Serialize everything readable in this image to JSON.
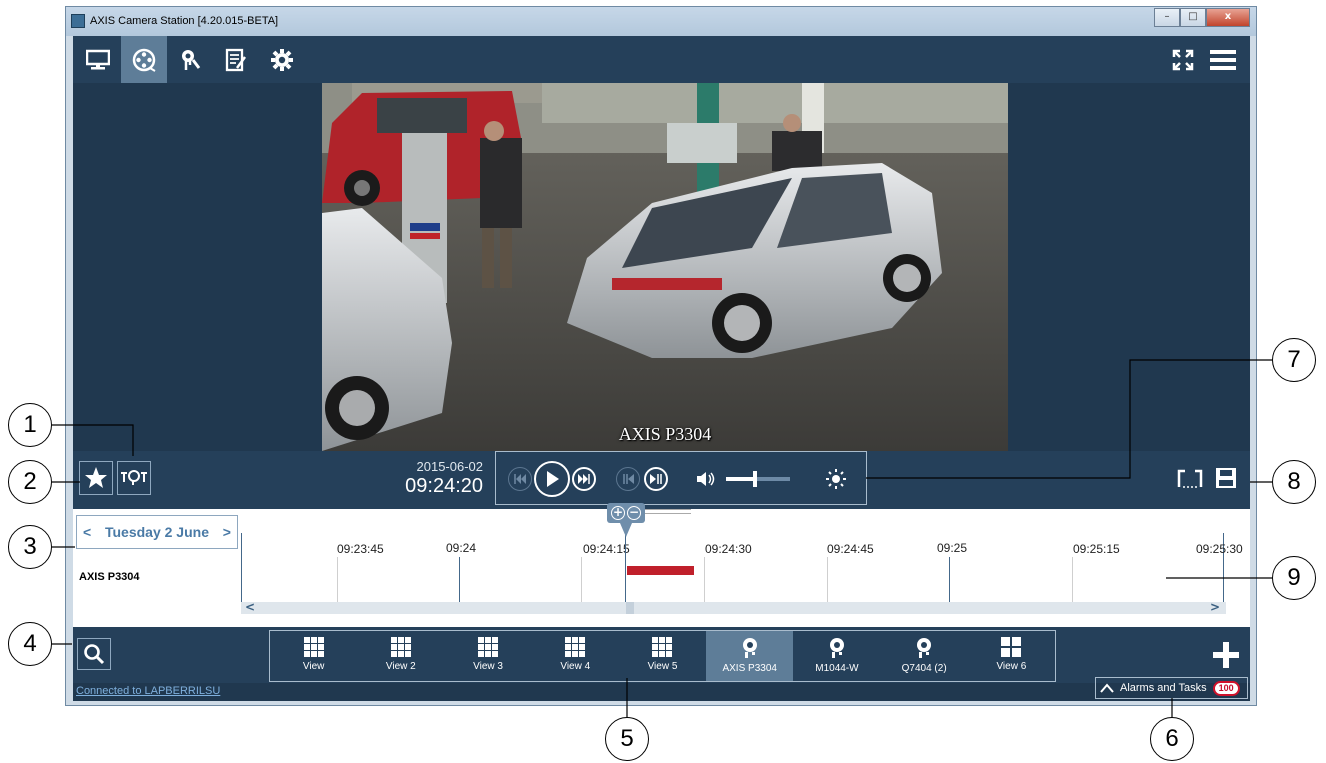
{
  "window": {
    "title": "AXIS Camera Station [4.20.015-BETA]",
    "controls": {
      "minimize": "–",
      "maximize": "□",
      "close": "x"
    }
  },
  "toolbar": {
    "tabs": [
      {
        "name": "live-view",
        "icon": "monitor-icon"
      },
      {
        "name": "recordings",
        "icon": "film-reel-icon",
        "active": true
      },
      {
        "name": "configuration",
        "icon": "camera-wrench-icon"
      },
      {
        "name": "logs",
        "icon": "report-icon"
      },
      {
        "name": "settings",
        "icon": "gear-icon"
      }
    ],
    "right": [
      {
        "icon": "fullscreen-icon"
      },
      {
        "icon": "hamburger-menu-icon"
      }
    ]
  },
  "video": {
    "caption": "AXIS P3304"
  },
  "controls": {
    "date": "2015-06-02",
    "time": "09:24:20",
    "left_buttons": [
      {
        "icon": "star-icon"
      },
      {
        "icon": "camera-tag-icon"
      }
    ],
    "playback": [
      "skip-back-icon",
      "play-icon",
      "skip-forward-icon",
      "step-back-icon",
      "step-forward-icon"
    ],
    "volume_icon": "speaker-icon",
    "volume_level": 0.45,
    "brightness_icon": "brightness-icon",
    "right_buttons": [
      {
        "icon": "export-markers-icon"
      },
      {
        "icon": "save-icon"
      }
    ],
    "zoom": {
      "plus": "+",
      "minus": "−"
    }
  },
  "timeline": {
    "date_label": "Tuesday 2 June",
    "prev": "<",
    "next": ">",
    "camera": "AXIS P3304",
    "ticks": [
      {
        "label": "09:23:45",
        "major": false
      },
      {
        "label": "09:24",
        "major": true
      },
      {
        "label": "09:24:15",
        "major": false
      },
      {
        "label": "09:24:30",
        "major": false
      },
      {
        "label": "09:24:45",
        "major": false
      },
      {
        "label": "09:25",
        "major": true
      },
      {
        "label": "09:25:15",
        "major": false
      },
      {
        "label": "09:25:30",
        "major": false
      }
    ],
    "scroll_left": "<",
    "scroll_right": ">"
  },
  "views": [
    {
      "label": "View",
      "icon": "grid-icon"
    },
    {
      "label": "View 2",
      "icon": "grid-icon"
    },
    {
      "label": "View 3",
      "icon": "grid-icon"
    },
    {
      "label": "View 4",
      "icon": "grid-icon"
    },
    {
      "label": "View 5",
      "icon": "grid-icon"
    },
    {
      "label": "AXIS P3304",
      "icon": "camera-icon",
      "active": true
    },
    {
      "label": "M1044-W",
      "icon": "camera-icon"
    },
    {
      "label": "Q7404 (2)",
      "icon": "camera-icon"
    },
    {
      "label": "View 6",
      "icon": "grid4-icon"
    }
  ],
  "bottom": {
    "search_icon": "search-icon",
    "add_icon": "plus-icon",
    "status": "Connected to LAPBERRILSU",
    "alarms_label": "Alarms and Tasks",
    "alarms_count": "100"
  },
  "callouts": [
    "1",
    "2",
    "3",
    "4",
    "5",
    "6",
    "7",
    "8",
    "9"
  ]
}
